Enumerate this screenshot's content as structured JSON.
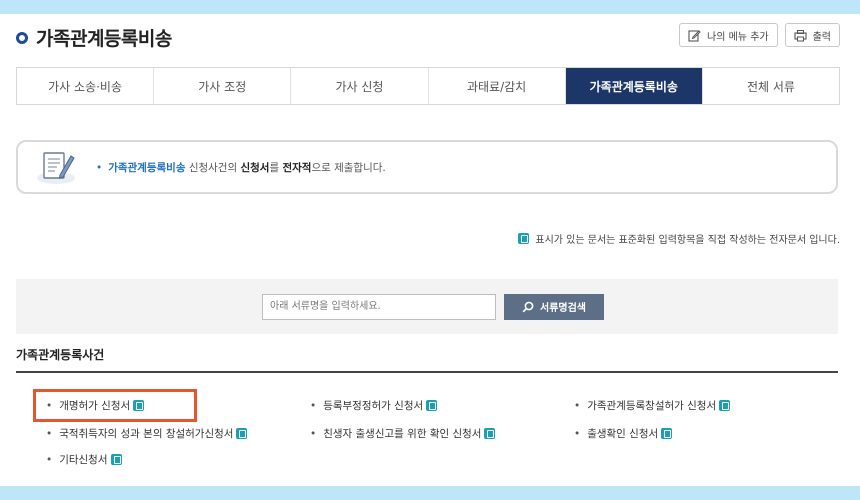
{
  "header": {
    "title": "가족관계등록비송",
    "add_menu_label": "나의 메뉴 추가",
    "print_label": "출력"
  },
  "tabs": [
    {
      "label": "가사 소송·비송",
      "active": false
    },
    {
      "label": "가사 조정",
      "active": false
    },
    {
      "label": "가사 신청",
      "active": false
    },
    {
      "label": "과태료/감치",
      "active": false
    },
    {
      "label": "가족관계등록비송",
      "active": true
    },
    {
      "label": "전체 서류",
      "active": false
    }
  ],
  "notice": {
    "bullet": "•",
    "part1": "가족관계등록비송",
    "part2": " 신청사건의 ",
    "part3": "신청서",
    "part4": "를 ",
    "part5": "전자적",
    "part6": "으로 제출합니다."
  },
  "edoc_note": "표시가 있는 문서는 표준화된 입력항목을 직접 작성하는 전자문서 입니다.",
  "search": {
    "placeholder": "아래 서류명을 입력하세요.",
    "button_label": "서류명검색"
  },
  "section": {
    "title": "가족관계등록사건",
    "items": [
      {
        "label": "개명허가 신청서",
        "edoc": true,
        "highlighted": true
      },
      {
        "label": "등록부정정허가 신청서",
        "edoc": true
      },
      {
        "label": "가족관계등록창설허가 신청서",
        "edoc": true
      },
      {
        "label": "국적취득자의 성과 본의 창설허가신청서",
        "edoc": true
      },
      {
        "label": "친생자 출생신고를 위한 확인 신청서",
        "edoc": true
      },
      {
        "label": "출생확인 신청서",
        "edoc": true
      },
      {
        "label": "기타신청서",
        "edoc": true
      }
    ]
  },
  "colors": {
    "accent_navy": "#1d3668",
    "link_blue": "#1f6fc5",
    "edoc_teal": "#1aa0b4",
    "highlight": "#e4572e",
    "band": "#bfe6f8"
  },
  "icons": [
    "edit-icon",
    "print-icon",
    "document-pen-icon",
    "search-icon",
    "edoc-icon"
  ]
}
